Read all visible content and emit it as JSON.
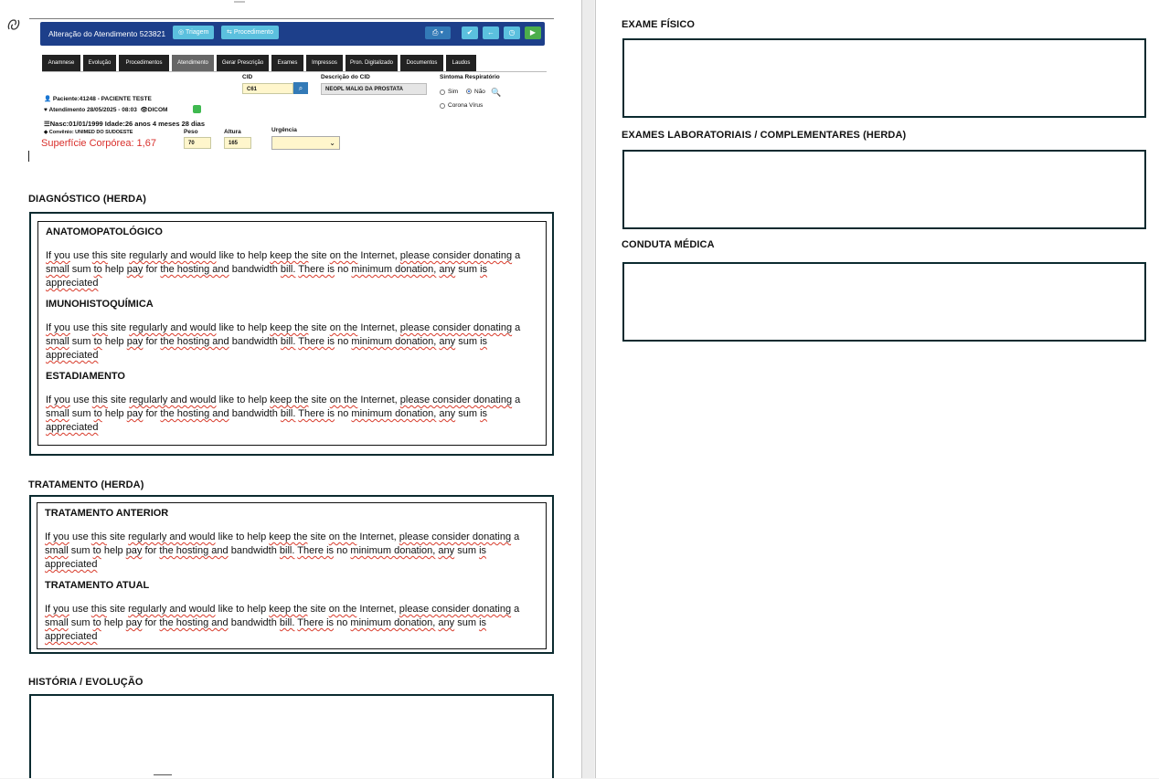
{
  "app_embed": {
    "title": "Alteração do Atendimento 523821",
    "btn_triagem": "Triagem",
    "btn_procedimento": "Procedimento",
    "tabs": [
      "Anamnese",
      "Evolução",
      "Procedimentos",
      "Atendimento",
      "Gerar Prescrição",
      "Exames",
      "Impressos",
      "Pron. Digitalizado",
      "Documentos",
      "Laudos"
    ],
    "active_tab": "Atendimento",
    "patient": "Paciente:41248 - PACIENTE TESTE",
    "attendance": "Atendimento 28/05/2025 - 08:03",
    "dicom": "DICOM",
    "birth": "Nasc:01/01/1999 Idade:26 anos 4 meses 28 dias",
    "insurance": "Convênio: UNIMED DO SUDOESTE",
    "surface": "Superfície Corpórea: 1,67",
    "cid_label": "CID",
    "cid_value": "C61",
    "cid_desc_label": "Descrição do CID",
    "cid_desc_value": "NEOPL MALIG DA PROSTATA",
    "symptom_label": "Sintoma Respiratório",
    "radio_sim": "Sim",
    "radio_nao": "Não",
    "radio_corona": "Corona Vírus",
    "peso_label": "Peso",
    "peso_value": "70",
    "altura_label": "Altura",
    "altura_value": "165",
    "urgencia_label": "Urgência"
  },
  "left": {
    "diag_heading": "DIAGNÓSTICO (HERDA)",
    "diag_sections": [
      {
        "title": "ANATOMOPATOLÓGICO"
      },
      {
        "title": "IMUNOHISTOQUÍMICA"
      },
      {
        "title": "ESTADIAMENTO"
      }
    ],
    "trat_heading": "TRATAMENTO (HERDA)",
    "trat_sections": [
      {
        "title": "TRATAMENTO ANTERIOR"
      },
      {
        "title": "TRATAMENTO ATUAL"
      }
    ],
    "historia_heading": "HISTÓRIA / EVOLUÇÃO"
  },
  "body_text": {
    "w1": "If you",
    "w2": "use",
    "w3": "this",
    "w4": "site",
    "w5": "regularly and would",
    "w6": "like to help",
    "w7": "keep the",
    "w8": "site",
    "w9": "on the",
    "w10": "Internet,",
    "w11": "please consider donating",
    "w12": "a",
    "w13": "small",
    "w14": "sum",
    "w15": "to",
    "w16": "help",
    "w17": "pay",
    "w18": "for",
    "w19": "the hosting and",
    "w20": "bandwidth",
    "w21": "bill.",
    "w22": "There is",
    "w23": "no",
    "w24": "minimum donation,",
    "w25": "any",
    "w26": "sum",
    "w27": "is",
    "w28": "appreciated"
  },
  "right": {
    "exame_fisico": "EXAME FÍSICO",
    "exames_lab": "EXAMES LABORATORIAIS / COMPLEMENTARES (HERDA)",
    "conduta": "CONDUTA MÉDICA"
  },
  "colors": {
    "box_border": "#0b2a2f",
    "header_blue": "#1d3f8a",
    "squiggle": "#d83b2b"
  }
}
